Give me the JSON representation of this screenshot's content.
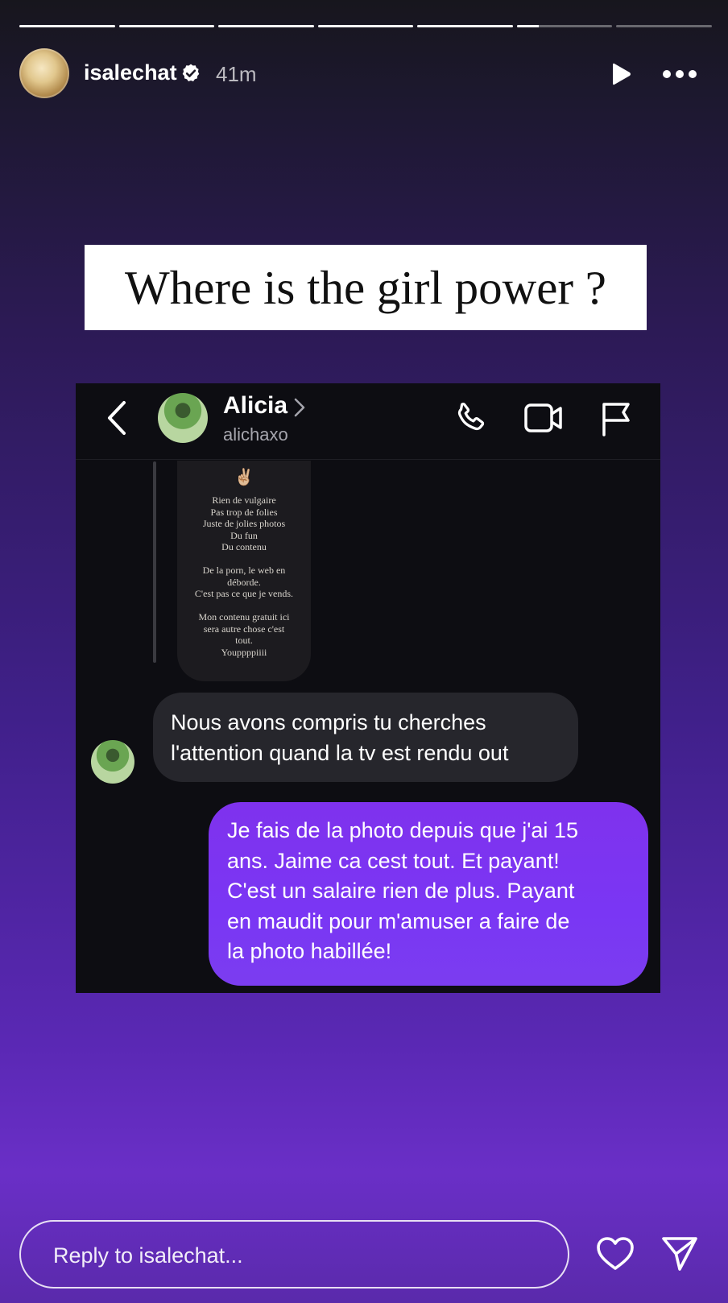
{
  "progress": {
    "segments": [
      1,
      1,
      1,
      1,
      1,
      0.23,
      0
    ]
  },
  "header": {
    "username": "isalechat",
    "verified": true,
    "time_ago": "41m",
    "icons": [
      "avatar",
      "verified-badge-icon",
      "play-icon",
      "more-icon"
    ]
  },
  "sticker": {
    "text": "Where is the girl power ?"
  },
  "screenshot": {
    "contact_name": "Alicia",
    "contact_handle": "alichaxo",
    "icons": [
      "back-icon",
      "chevron-right-icon",
      "phone-icon",
      "video-icon",
      "flag-icon"
    ],
    "story_emoji": "✌🏼",
    "story_text": "Rien de vulgaire\nPas trop de folies\nJuste de jolies photos\nDu fun\nDu contenu\n\nDe la porn, le web en\ndéborde.\nC'est pas ce que je vends.\n\nMon contenu gratuit ici\nsera autre chose c'est\ntout.\nYouppppiiii",
    "incoming_message": "Nous avons compris tu cherches\nl'attention quand la tv est rendu out",
    "outgoing_message": "Je fais de la photo depuis que j'ai 15\nans. Jaime ca cest tout. Et payant!\nC'est un salaire rien de plus. Payant\nen maudit pour m'amuser a faire de\nla photo habillée!",
    "outgoing_color": "#7f32ed"
  },
  "reply": {
    "placeholder": "Reply to isalechat...",
    "icons": [
      "heart-icon",
      "send-icon"
    ]
  }
}
